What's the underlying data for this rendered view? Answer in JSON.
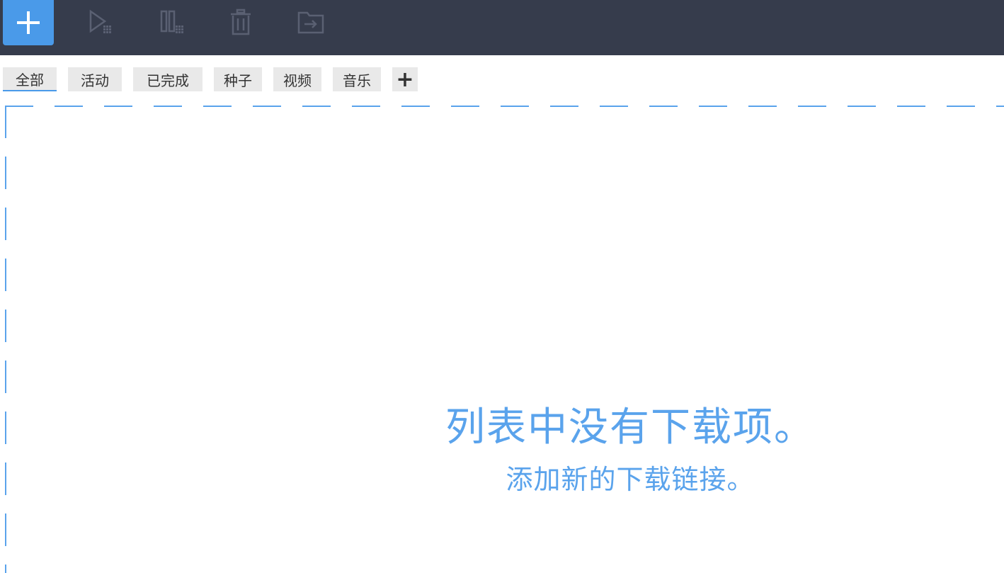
{
  "toolbar": {
    "buttons": [
      {
        "name": "add-download",
        "icon": "plus-icon",
        "enabled": true
      },
      {
        "name": "resume-all",
        "icon": "play-grid-icon",
        "enabled": false
      },
      {
        "name": "pause-all",
        "icon": "pause-grid-icon",
        "enabled": false
      },
      {
        "name": "delete",
        "icon": "trash-icon",
        "enabled": false
      },
      {
        "name": "open-folder",
        "icon": "folder-arrow-icon",
        "enabled": false
      }
    ],
    "background": "#363c4c",
    "accent": "#4a9ae9"
  },
  "tabs": {
    "items": [
      {
        "label": "全部",
        "active": true
      },
      {
        "label": "活动",
        "active": false
      },
      {
        "label": "已完成",
        "active": false
      },
      {
        "label": "种子",
        "active": false
      },
      {
        "label": "视频",
        "active": false
      },
      {
        "label": "音乐",
        "active": false
      }
    ],
    "add_label": "+"
  },
  "empty_state": {
    "title": "列表中没有下载项。",
    "subtitle": "添加新的下载链接。",
    "color": "#5aa3ec"
  }
}
